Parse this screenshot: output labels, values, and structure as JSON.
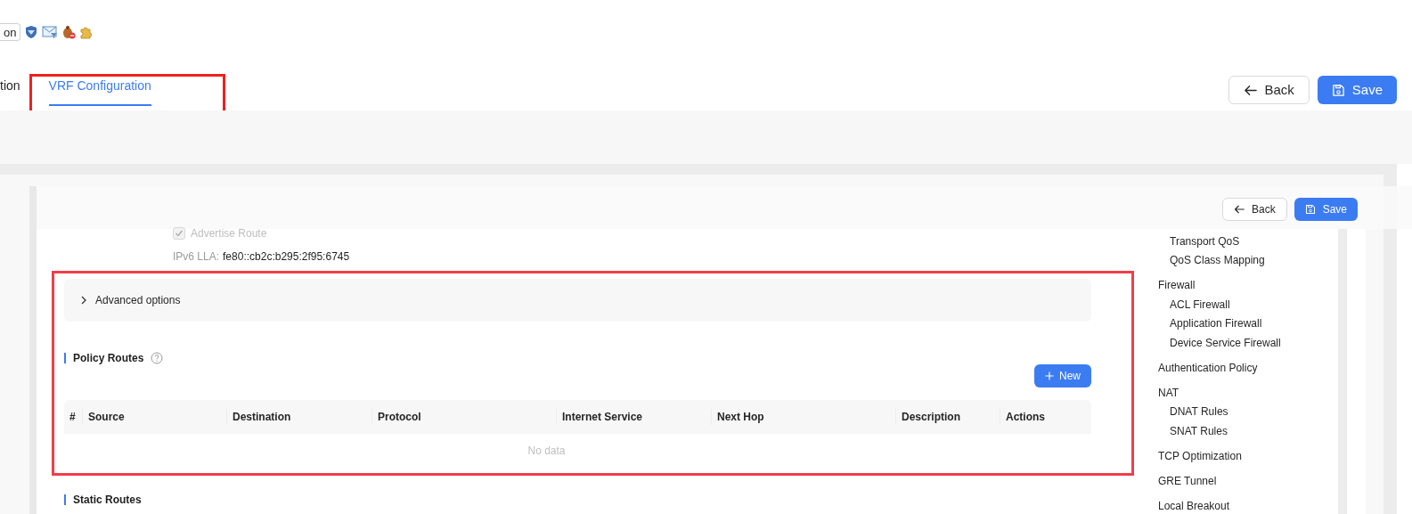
{
  "toolbar": {
    "button": "on"
  },
  "tabs": [
    {
      "label": "tion",
      "selected": false
    },
    {
      "label": "VRF Configuration",
      "selected": true
    }
  ],
  "header_buttons": [
    {
      "kind": "back",
      "label": "Back"
    },
    {
      "kind": "save",
      "label": "Save"
    }
  ],
  "inner_buttons": [
    {
      "kind": "back",
      "label": "Back"
    },
    {
      "kind": "save",
      "label": "Save"
    }
  ],
  "advertise_route": {
    "label": "Advertise Route",
    "checked": true,
    "disabled": true
  },
  "ipv6_lla": {
    "label": "IPv6 LLA:",
    "value": "fe80::cb2c:b295:2f95:6745"
  },
  "advanced_options": {
    "label": "Advanced options",
    "expanded": false
  },
  "policy_routes": {
    "title": "Policy Routes",
    "new_button": "New",
    "columns": [
      "#",
      "Source",
      "Destination",
      "Protocol",
      "Internet Service",
      "Next Hop",
      "Description",
      "Actions"
    ],
    "empty_text": "No data"
  },
  "static_routes": {
    "title": "Static Routes"
  },
  "side_menu": [
    {
      "children": [
        {
          "label": "Transport QoS"
        },
        {
          "label": "QoS Class Mapping"
        }
      ]
    },
    {
      "label": "Firewall",
      "children": [
        {
          "label": "ACL Firewall"
        },
        {
          "label": "Application Firewall"
        },
        {
          "label": "Device Service Firewall"
        }
      ]
    },
    {
      "label": "Authentication Policy"
    },
    {
      "label": "NAT",
      "children": [
        {
          "label": "DNAT Rules"
        },
        {
          "label": "SNAT Rules"
        }
      ]
    },
    {
      "label": "TCP Optimization"
    },
    {
      "label": "GRE Tunnel"
    },
    {
      "label": "Local Breakout"
    }
  ]
}
